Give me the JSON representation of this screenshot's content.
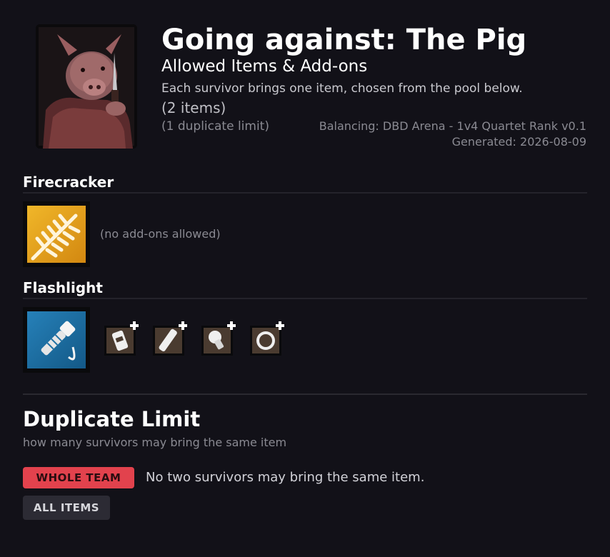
{
  "header": {
    "title": "Going against: The Pig",
    "subtitle": "Allowed Items & Add-ons",
    "description": "Each survivor brings one item, chosen from the pool below.",
    "item_count": "(2 items)",
    "duplicate_limit": "(1 duplicate limit)",
    "balancing": "Balancing: DBD Arena - 1v4 Quartet Rank v0.1",
    "generated": "Generated: 2026-08-09",
    "portrait_icon": "the-pig-portrait"
  },
  "items": [
    {
      "name": "Firecracker",
      "icon": "firecracker-icon",
      "icon_color": "#e8a21a",
      "addons_note": "(no add-ons allowed)",
      "addons": []
    },
    {
      "name": "Flashlight",
      "icon": "flashlight-icon",
      "icon_color": "#1d6fa3",
      "addons_note": "",
      "addons": [
        {
          "icon": "battery-addon-icon"
        },
        {
          "icon": "tube-addon-icon"
        },
        {
          "icon": "bulb-addon-icon"
        },
        {
          "icon": "lens-addon-icon"
        }
      ]
    }
  ],
  "duplicate": {
    "title": "Duplicate Limit",
    "subtitle": "how many survivors may bring the same item",
    "whole_team_label": "WHOLE TEAM",
    "whole_team_text": "No two survivors may bring the same item.",
    "all_items_label": "ALL ITEMS",
    "accent_color": "#e2424d"
  }
}
